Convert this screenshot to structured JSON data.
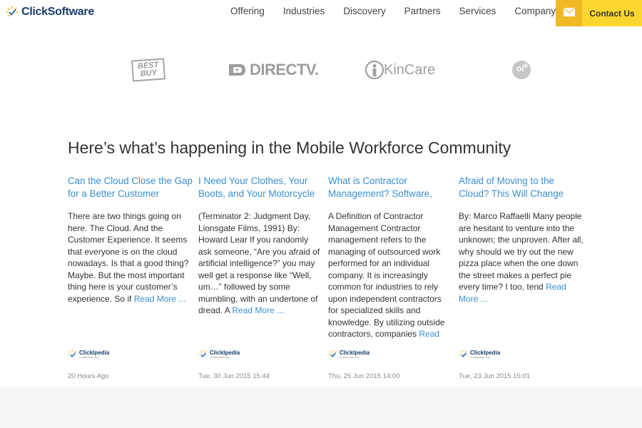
{
  "header": {
    "logo_text": "ClickSoftware",
    "nav": [
      "Offering",
      "Industries",
      "Discovery",
      "Partners",
      "Services",
      "Company"
    ],
    "contact_label": "Contact Us"
  },
  "clients": {
    "bestbuy_top": "BEST",
    "bestbuy_bottom": "BUY",
    "directv": "DIRECTV.",
    "kincare": "KinCare",
    "oi": "oi"
  },
  "section_title": "Here’s what’s happening in the Mobile Workforce Community",
  "badge_label": "ClickIpedia",
  "badge_sub": "A ClickSoftware blog",
  "posts": [
    {
      "title": "Can the Cloud Close the Gap for a Better Customer",
      "excerpt": "There are two things going on here.  The Cloud.  And the Customer Experience.  It seems that everyone is on the cloud nowadays.  Is that a good thing?  Maybe.  But the most important thing here is your customer’s experience.  So if",
      "more": "Read More ...",
      "date": "20 Hours Ago"
    },
    {
      "title": "I Need Your Clothes, Your Boots, and Your Motorcycle",
      "excerpt": "(Terminator 2: Judgment Day, Lionsgate Films, 1991) By: Howard Lear If you randomly ask someone, “Are you afraid of artificial intelligence?” you may well get a response like “Well, um…” followed by some mumbling, with an undertone of dread. A",
      "more": "Read More ...",
      "date": "Tue, 30 Jun 2015 15:44"
    },
    {
      "title": "What is Contractor Management? Software,",
      "excerpt": "A Definition of Contractor Management Contractor management refers to the managing of outsourced work performed for an individual company. It is increasingly common for industries to rely upon independent contractors for specialized skills and knowledge. By utilizing outside contractors, companies",
      "more": "Read",
      "date": "Thu, 25 Jun 2015 14:00"
    },
    {
      "title": "Afraid of Moving to the Cloud? This Will Change",
      "excerpt": "By: Marco Raffaelli Many people are hesitant to venture into the unknown; the unproven. After all, why should we try out the new pizza place when the one down the street makes a perfect pie every time? I too, tend",
      "more": "Read More ...",
      "date": "Tue, 23 Jun 2015 15:01"
    }
  ],
  "colors": {
    "link": "#3a8fd1",
    "contact_bg": "#fbd630",
    "mail_bg": "#f1b826",
    "brand_navy": "#1a3b6a"
  },
  "icons": {
    "logo": "clicksoftware-sunburst-icon",
    "mail": "envelope-icon",
    "badge": "clickipedia-check-icon"
  }
}
